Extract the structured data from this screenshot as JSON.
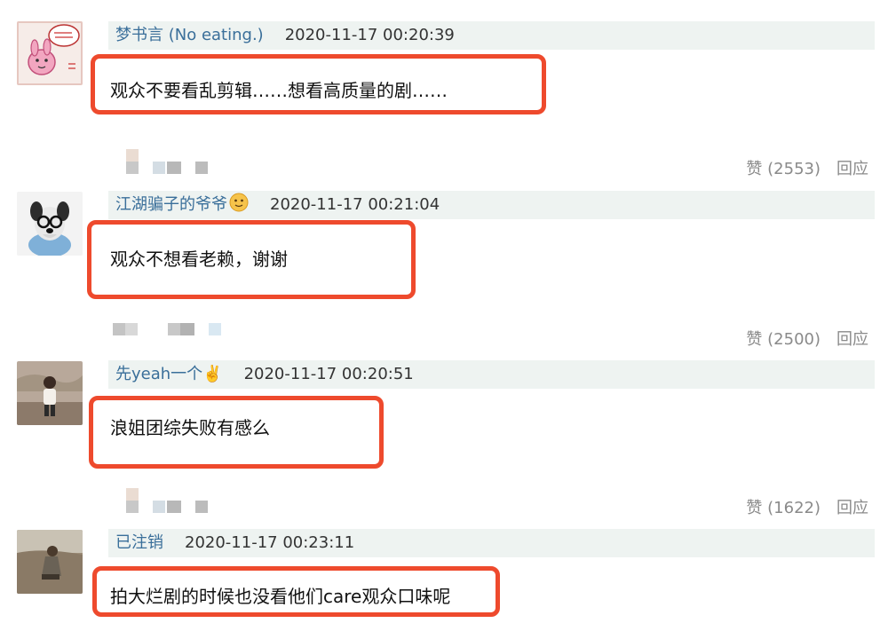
{
  "comments": [
    {
      "username": "梦书言",
      "user_tag": "(No eating.)",
      "time": "2020-11-17 00:20:39",
      "text": "观众不要看乱剪辑……想看高质量的剧……",
      "like_label": "赞 (2553)",
      "reply_label": "回应"
    },
    {
      "username": "江湖骗子的爷爷",
      "user_tag": "",
      "time": "2020-11-17 00:21:04",
      "text": "观众不想看老赖，谢谢",
      "like_label": "赞 (2500)",
      "reply_label": "回应"
    },
    {
      "username": "先yeah一个✌️",
      "user_tag": "",
      "time": "2020-11-17 00:20:51",
      "text": "浪姐团综失败有感么",
      "like_label": "赞 (1622)",
      "reply_label": "回应"
    },
    {
      "username": "已注销",
      "user_tag": "",
      "time": "2020-11-17 00:23:11",
      "text": "拍大烂剧的时候也没看他们care观众口味呢",
      "like_label": "",
      "reply_label": ""
    }
  ],
  "colors": {
    "highlight": "#ee4a2d",
    "meta_bg": "#eef3f1",
    "username": "#3a6f9a",
    "action": "#8a8a8a"
  },
  "icons": [
    "avatar-cartoon",
    "avatar-dog",
    "avatar-child",
    "avatar-person",
    "smiley-emoji-icon"
  ]
}
